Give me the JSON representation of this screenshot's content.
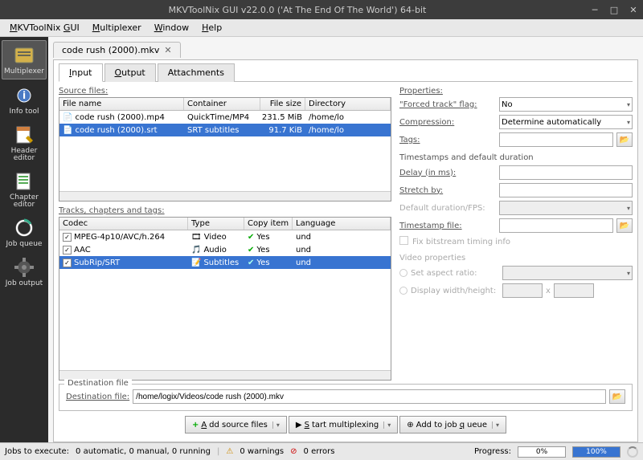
{
  "window": {
    "title": "MKVToolNix GUI v22.0.0 ('At The End Of The World') 64-bit"
  },
  "menubar": [
    "MKVToolNix GUI",
    "Multiplexer",
    "Window",
    "Help"
  ],
  "sidebar": {
    "items": [
      {
        "label": "Multiplexer"
      },
      {
        "label": "Info tool"
      },
      {
        "label": "Header editor"
      },
      {
        "label": "Chapter editor"
      },
      {
        "label": "Job queue"
      },
      {
        "label": "Job output"
      }
    ]
  },
  "filetab": {
    "name": "code rush (2000).mkv"
  },
  "subtabs": {
    "input": "Input",
    "output": "Output",
    "attachments": "Attachments"
  },
  "source": {
    "label": "Source files:",
    "headers": {
      "filename": "File name",
      "container": "Container",
      "filesize": "File size",
      "directory": "Directory"
    },
    "rows": [
      {
        "filename": "code rush (2000).mp4",
        "container": "QuickTime/MP4",
        "filesize": "231.5 MiB",
        "directory": "/home/lo"
      },
      {
        "filename": "code rush (2000).srt",
        "container": "SRT subtitles",
        "filesize": "91.7 KiB",
        "directory": "/home/lo"
      }
    ]
  },
  "tracks": {
    "label": "Tracks, chapters and tags:",
    "headers": {
      "codec": "Codec",
      "type": "Type",
      "copy": "Copy item",
      "lang": "Language"
    },
    "rows": [
      {
        "codec": "MPEG-4p10/AVC/h.264",
        "type": "Video",
        "copy": "Yes",
        "lang": "und"
      },
      {
        "codec": "AAC",
        "type": "Audio",
        "copy": "Yes",
        "lang": "und"
      },
      {
        "codec": "SubRip/SRT",
        "type": "Subtitles",
        "copy": "Yes",
        "lang": "und"
      }
    ]
  },
  "props": {
    "label": "Properties:",
    "forced_label": "\"Forced track\" flag:",
    "forced_value": "No",
    "compression_label": "Compression:",
    "compression_value": "Determine automatically",
    "tags_label": "Tags:",
    "tags_value": "",
    "timestamps_label": "Timestamps and default duration",
    "delay_label": "Delay (in ms):",
    "delay_value": "",
    "stretch_label": "Stretch by:",
    "stretch_value": "",
    "defaultdur_label": "Default duration/FPS:",
    "timestampfile_label": "Timestamp file:",
    "timestampfile_value": "",
    "fixbitstream_label": "Fix bitstream timing info",
    "video_label": "Video properties",
    "aspect_label": "Set aspect ratio:",
    "display_label": "Display width/height:",
    "x": "x"
  },
  "dest": {
    "legend": "Destination file",
    "label": "Destination file:",
    "value": "/home/logix/Videos/code rush (2000).mkv"
  },
  "actions": {
    "add": "Add source files",
    "start": "Start multiplexing",
    "queue": "Add to job queue"
  },
  "status": {
    "jobs_label": "Jobs to execute:",
    "jobs_value": "0 automatic, 0 manual, 0 running",
    "warnings": "0 warnings",
    "errors": "0 errors",
    "progress_label": "Progress:",
    "p1": "0%",
    "p2": "100%"
  }
}
